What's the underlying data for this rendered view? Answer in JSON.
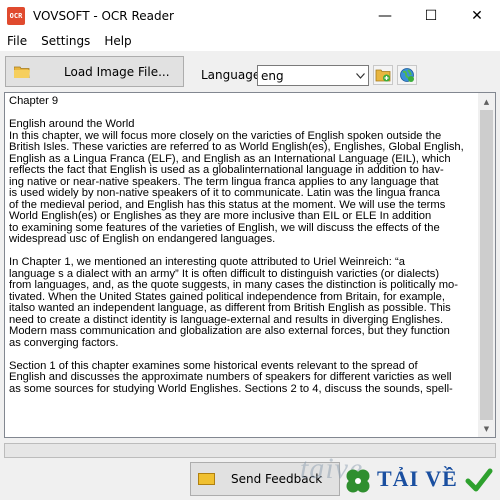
{
  "window": {
    "icon_text": "OCR",
    "title": "VOVSOFT - OCR Reader",
    "minimize": "—",
    "maximize": "☐",
    "close": "✕"
  },
  "menu": [
    "File",
    "Settings",
    "Help"
  ],
  "toolbar": {
    "load_button": "Load Image File...",
    "language_label": "Language:",
    "language_value": "eng"
  },
  "document": {
    "text": "Chapter 9\n\nEnglish around the World\nIn this chapter, we will focus more closely on the varicties of English spoken outside the\nBritish Isles. These varicties are referred to as World English(es), Englishes, Global English,\nEnglish as a Lingua Franca (ELF), and English as an International Language (EIL), which\nreflects the fact that English is used as a globalinternational language in addition to hav-\ning native or near-native speakers. The term lingua franca applies to any language that\nis used widely by non-native speakers of it to communicate. Latin was the lingua franca\nof the medieval period, and English has this status at the moment. We will use the terms\nWorld English(es) or Englishes as they are more inclusive than EIL or ELE In addition\nto examining some features of the varieties of English, we will discuss the effects of the\nwidespread usc of English on endangered languages.\n\nIn Chapter 1, we mentioned an interesting quote attributed to Uriel Weinreich: “a\nlanguage s a dialect with an army” It is often difficult to distinguish varicties (or dialects)\nfrom languages, and, as the quote suggests, in many cases the distinction is politically mo-\ntivated. When the United States gained political independence from Britain, for example,\nitalso wanted an independent language, as different from British English as possible. This\nneed to create a distinct identity is language-external and results in diverging Englishes.\nModern mass communication and globalization are also external forces, but they function\nas converging factors.\n\nSection 1 of this chapter examines some historical events relevant to the spread of\nEnglish and discusses the approximate numbers of speakers for different varicties as well\nas some sources for studying World Englishes. Sections 2 to 4, discuss the sounds, spell-"
  },
  "footer": {
    "feedback_button": "Send Feedback",
    "watermark": "taive",
    "brand": "TẢI VỀ"
  },
  "colors": {
    "brand_blue": "#1a4fa0",
    "check_green": "#2ea12e",
    "clover_green": "#2f8f2f"
  }
}
